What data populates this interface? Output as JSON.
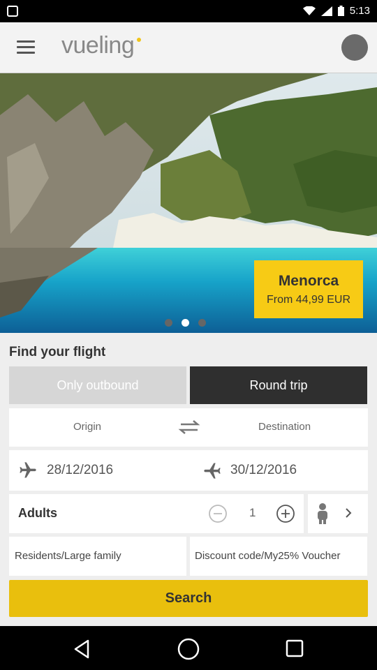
{
  "status_bar": {
    "time": "5:13"
  },
  "app_bar": {
    "logo_text": "vueling",
    "accent": "#f0c419"
  },
  "hero": {
    "promo_city": "Menorca",
    "promo_price": "From 44,99 EUR",
    "carousel": {
      "count": 3,
      "active": 2
    }
  },
  "form": {
    "title": "Find your flight",
    "trip_types": {
      "outbound": "Only outbound",
      "round": "Round trip"
    },
    "origin_label": "Origin",
    "destination_label": "Destination",
    "depart_date": "28/12/2016",
    "return_date": "30/12/2016",
    "adults_label": "Adults",
    "adults_count": "1",
    "residents_label": "Residents/Large family",
    "discount_label": "Discount code/My25% Voucher",
    "search_label": "Search"
  },
  "colors": {
    "yellow": "#f7cb15",
    "search": "#e9bf0d",
    "dark": "#2f2f2f"
  }
}
